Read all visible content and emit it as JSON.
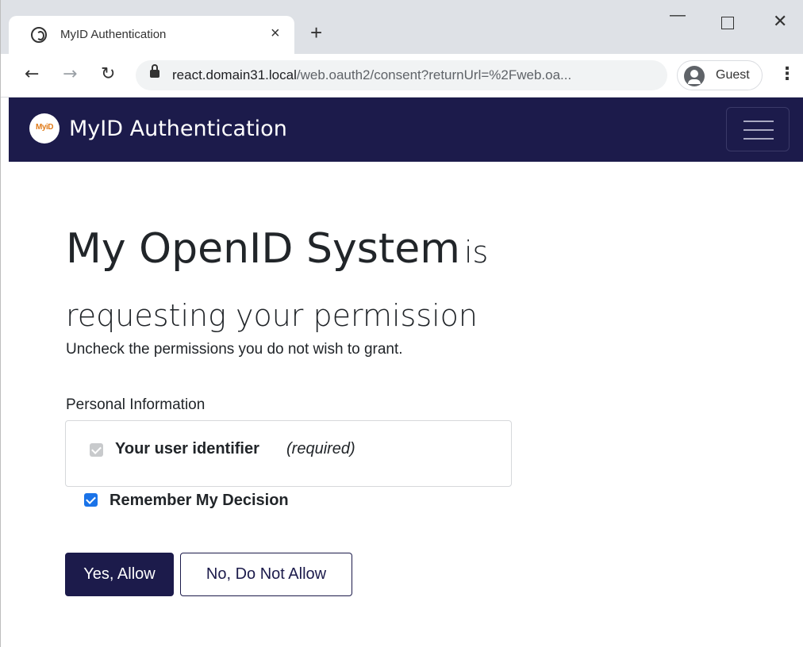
{
  "browser": {
    "tab_title": "MyID Authentication",
    "tab_close": "×",
    "new_tab": "+",
    "url_host": "react.domain31.local",
    "url_rest": "/web.oauth2/consent?returnUrl=%2Fweb.oa...",
    "profile_label": "Guest",
    "back_glyph": "←",
    "forward_glyph": "→",
    "reload_glyph": "↻",
    "menu_glyph": "⋮",
    "min_glyph": "—",
    "close_glyph": "✕"
  },
  "navbar": {
    "logo_text": "MyiD",
    "brand": "MyID Authentication"
  },
  "consent": {
    "app_name": "My OpenID System",
    "heading_rest": "is requesting your permission",
    "subtitle": "Uncheck the permissions you do not wish to grant.",
    "group_label": "Personal Information",
    "scopes": [
      {
        "name": "Your user identifier",
        "note": "(required)",
        "checked": true,
        "disabled": true
      }
    ],
    "remember_label": "Remember My Decision",
    "remember_checked": true,
    "allow_label": "Yes, Allow",
    "deny_label": "No, Do Not Allow"
  },
  "colors": {
    "navbar_bg": "#1c1b4b",
    "primary": "#1c1b4b",
    "checkbox_accent": "#1a73e8"
  },
  "icons": [
    "tab-favicon-icon",
    "lock-icon",
    "guest-profile-icon",
    "hamburger-menu-icon"
  ]
}
